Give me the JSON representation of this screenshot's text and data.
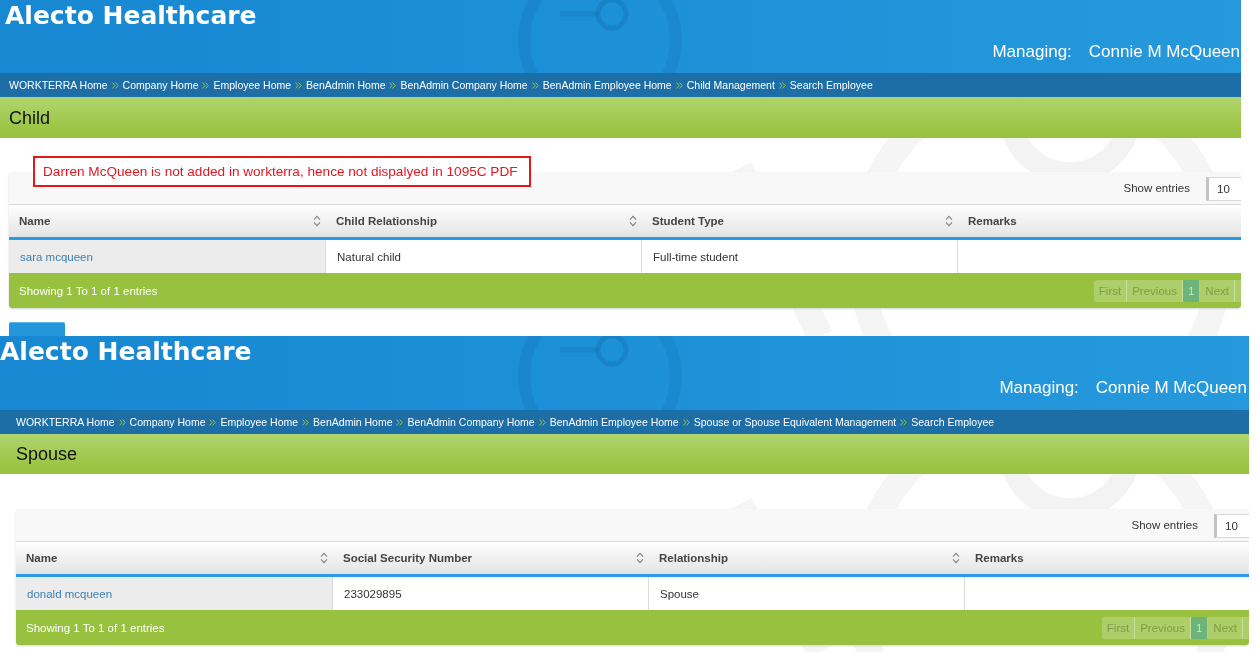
{
  "screens": [
    {
      "header": {
        "title": "Alecto Healthcare",
        "managing_label": "Managing:",
        "managing_name": "Connie M McQueen"
      },
      "breadcrumbs": [
        "WORKTERRA Home",
        "Company Home",
        "Employee Home",
        "BenAdmin Home",
        "BenAdmin Company Home",
        "BenAdmin Employee Home",
        "Child Management",
        "Search Employee"
      ],
      "section_title": "Child",
      "annotation": "Darren McQueen is not added in workterra, hence not dispalyed in 1095C PDF",
      "table": {
        "show_entries_label": "Show entries",
        "page_size": "10",
        "columns": [
          {
            "label": "Name",
            "sortable": true,
            "sorted": true
          },
          {
            "label": "Child Relationship",
            "sortable": true,
            "sorted": false
          },
          {
            "label": "Student Type",
            "sortable": true,
            "sorted": false
          },
          {
            "label": "Remarks",
            "sortable": false,
            "sorted": false
          }
        ],
        "rows": [
          {
            "cells": [
              "sara mcqueen",
              "Natural child",
              "Full-time student"
            ]
          }
        ],
        "info": "Showing 1 To 1 of 1 entries",
        "pagination": [
          {
            "label": "First",
            "selected": false,
            "disabled": true
          },
          {
            "label": "Previous",
            "selected": false,
            "disabled": true
          },
          {
            "label": "1",
            "selected": true,
            "disabled": false
          },
          {
            "label": "Next",
            "selected": false,
            "disabled": true
          }
        ]
      },
      "partial_button": true
    },
    {
      "header": {
        "title": "Alecto Healthcare",
        "managing_label": "Managing:",
        "managing_name": "Connie M McQueen"
      },
      "breadcrumbs": [
        "WORKTERRA Home",
        "Company Home",
        "Employee Home",
        "BenAdmin Home",
        "BenAdmin Company Home",
        "BenAdmin Employee Home",
        "Spouse or Spouse Equivalent Management",
        "Search Employee"
      ],
      "section_title": "Spouse",
      "table": {
        "show_entries_label": "Show entries",
        "page_size": "10",
        "columns": [
          {
            "label": "Name",
            "sortable": true,
            "sorted": true
          },
          {
            "label": "Social Security Number",
            "sortable": true,
            "sorted": false
          },
          {
            "label": "Relationship",
            "sortable": true,
            "sorted": false
          },
          {
            "label": "Remarks",
            "sortable": false,
            "sorted": false
          }
        ],
        "rows": [
          {
            "cells": [
              "donald mcqueen",
              "233029895",
              "Spouse"
            ]
          }
        ],
        "info": "Showing 1 To 1 of 1 entries",
        "pagination": [
          {
            "label": "First",
            "selected": false,
            "disabled": true
          },
          {
            "label": "Previous",
            "selected": false,
            "disabled": true
          },
          {
            "label": "1",
            "selected": true,
            "disabled": false
          },
          {
            "label": "Next",
            "selected": false,
            "disabled": true
          }
        ]
      }
    }
  ]
}
